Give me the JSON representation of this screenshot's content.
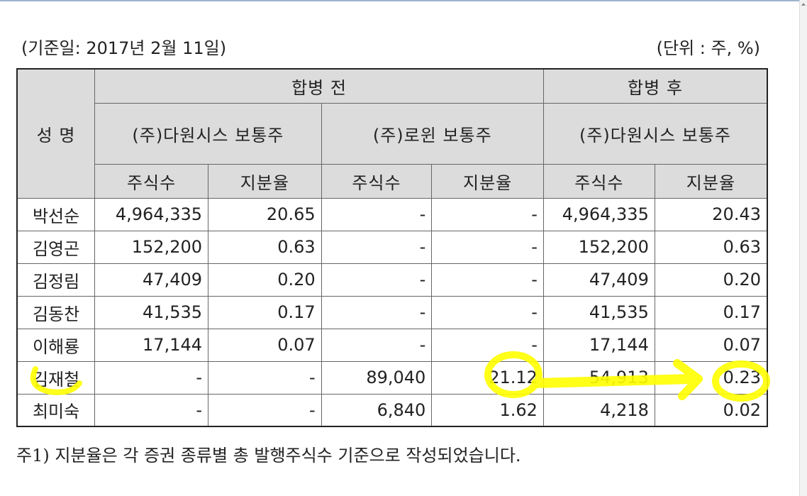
{
  "caption": {
    "date": "(기준일: 2017년 2월 11일)",
    "unit": "(단위 : 주, %)"
  },
  "headers": {
    "name": "성 명",
    "before": "합병 전",
    "after": "합병 후",
    "co1": "(주)다원시스 보통주",
    "co2": "(주)로윈 보통주",
    "co3": "(주)다원시스 보통주",
    "shares": "주식수",
    "ratio": "지분율"
  },
  "rows": [
    {
      "name": "박선순",
      "c1": "4,964,335",
      "c2": "20.65",
      "c3": "-",
      "c4": "-",
      "c5": "4,964,335",
      "c6": "20.43"
    },
    {
      "name": "김영곤",
      "c1": "152,200",
      "c2": "0.63",
      "c3": "-",
      "c4": "-",
      "c5": "152,200",
      "c6": "0.63"
    },
    {
      "name": "김정림",
      "c1": "47,409",
      "c2": "0.20",
      "c3": "-",
      "c4": "-",
      "c5": "47,409",
      "c6": "0.20"
    },
    {
      "name": "김동찬",
      "c1": "41,535",
      "c2": "0.17",
      "c3": "-",
      "c4": "-",
      "c5": "41,535",
      "c6": "0.17"
    },
    {
      "name": "이해룡",
      "c1": "17,144",
      "c2": "0.07",
      "c3": "-",
      "c4": "-",
      "c5": "17,144",
      "c6": "0.07"
    },
    {
      "name": "김재철",
      "c1": "-",
      "c2": "-",
      "c3": "89,040",
      "c4": "21.12",
      "c5": "54,913",
      "c6": "0.23"
    },
    {
      "name": "최미숙",
      "c1": "-",
      "c2": "-",
      "c3": "6,840",
      "c4": "1.62",
      "c5": "4,218",
      "c6": "0.02"
    }
  ],
  "note": "주1) 지분율은 각 증권 종류별 총 발행주식수 기준으로 작성되었습니다.",
  "highlight_color": "#ffff00"
}
